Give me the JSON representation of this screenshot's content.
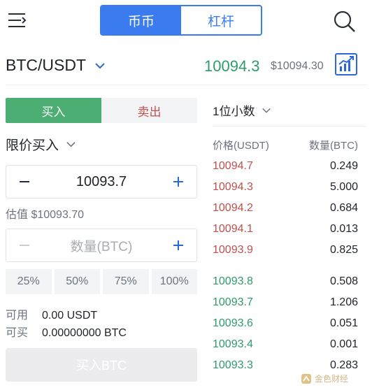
{
  "header": {
    "tabs": [
      {
        "label": "币币",
        "active": true
      },
      {
        "label": "杠杆",
        "active": false
      }
    ]
  },
  "pair": {
    "name": "BTC/USDT",
    "last_price": "10094.3",
    "fiat_price": "$10094.30"
  },
  "trade": {
    "buy_label": "买入",
    "sell_label": "卖出",
    "order_type": "限价买入",
    "price_value": "10093.7",
    "estimate": "估值 $10093.70",
    "amount_placeholder": "数量(BTC)",
    "percents": [
      "25%",
      "50%",
      "75%",
      "100%"
    ],
    "available_label": "可用",
    "available_value": "0.00 USDT",
    "buyable_label": "可买",
    "buyable_value": "0.00000000 BTC",
    "submit_label": "买入BTC"
  },
  "orderbook": {
    "decimals": "1位小数",
    "price_header": "价格(USDT)",
    "qty_header": "数量(BTC)",
    "asks": [
      {
        "price": "10094.7",
        "qty": "0.249"
      },
      {
        "price": "10094.3",
        "qty": "5.000"
      },
      {
        "price": "10094.2",
        "qty": "0.684"
      },
      {
        "price": "10094.1",
        "qty": "0.013"
      },
      {
        "price": "10093.9",
        "qty": "0.825"
      }
    ],
    "bids": [
      {
        "price": "10093.8",
        "qty": "0.508"
      },
      {
        "price": "10093.7",
        "qty": "1.206"
      },
      {
        "price": "10093.6",
        "qty": "0.051"
      },
      {
        "price": "10093.4",
        "qty": "0.001"
      },
      {
        "price": "10093.3",
        "qty": "0.283"
      }
    ]
  },
  "watermark": "金色财经",
  "colors": {
    "accent": "#3a7cf0",
    "buy": "#4cae73",
    "sell": "#c0504d",
    "up": "#2e9b6c"
  },
  "icons": [
    "menu-icon",
    "search-icon",
    "chevron-down-icon",
    "chart-icon",
    "minus-icon",
    "plus-icon"
  ]
}
